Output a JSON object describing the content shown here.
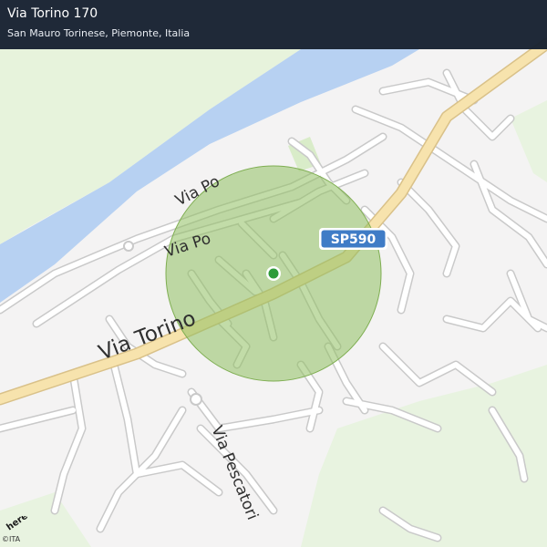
{
  "header": {
    "title": "Via Torino 170",
    "subtitle": "San Mauro Torinese, Piemonte, Italia"
  },
  "map": {
    "streets": {
      "via_po_upper": "Via Po",
      "via_po_lower": "Via Po",
      "via_torino": "Via Torino",
      "via_pescatori": "Via Pescatori"
    },
    "road_shield": "SP590",
    "logo_text": "here",
    "copyright": "©ITA",
    "colors": {
      "land": "#f4f3f3",
      "river": "#b7d1f2",
      "park": "#e7f3dc",
      "main_road": "#f7e3ad",
      "minor_road": "#ffffff",
      "road_outline": "#c9c9c9",
      "accuracy_circle": "#8fbf60",
      "location_dot": "#2e9b3a",
      "shield": "#3f7cc6"
    }
  }
}
